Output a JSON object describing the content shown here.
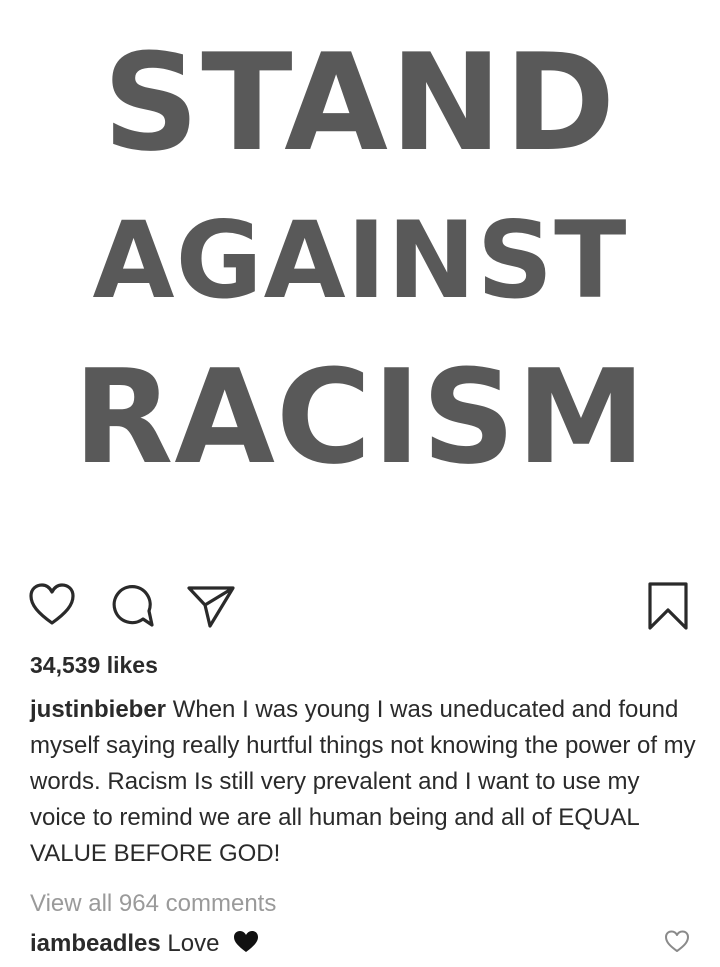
{
  "post": {
    "image_text": {
      "line1": "STAND",
      "line2": "AGAINST",
      "line3": "RACISM"
    }
  },
  "actions": {
    "like_icon": "heart-outline-icon",
    "comment_icon": "comment-bubble-icon",
    "share_icon": "paper-plane-icon",
    "save_icon": "bookmark-icon"
  },
  "likes": {
    "count_text": "34,539 likes"
  },
  "caption": {
    "username": "justinbieber",
    "text": "When I was young I was uneducated and found myself saying really hurtful things not knowing the power of my words. Racism Is still very prevalent and I want to use my voice to remind we are all human being and all of EQUAL VALUE BEFORE GOD!"
  },
  "comments": {
    "view_all_label": "View all 964 comments",
    "items": [
      {
        "username": "iambeadles",
        "text": "Love",
        "emoji_icon": "black-heart-icon",
        "like_icon": "heart-outline-small-icon"
      }
    ]
  },
  "colors": {
    "headline": "#595959",
    "text": "#2a2a2a",
    "muted": "#9a9a9a"
  }
}
